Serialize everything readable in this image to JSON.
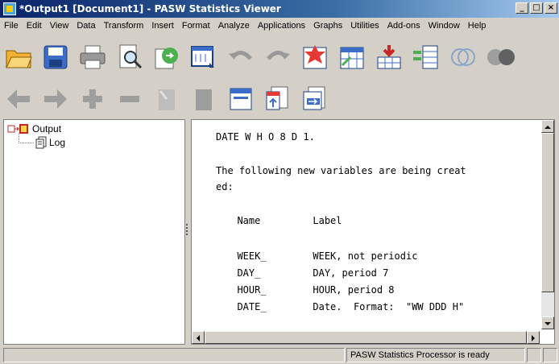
{
  "window": {
    "title": "*Output1 [Document1] - PASW Statistics Viewer",
    "controls": [
      "_",
      "□",
      "×"
    ]
  },
  "menu": [
    {
      "label": "File"
    },
    {
      "label": "Edit"
    },
    {
      "label": "View"
    },
    {
      "label": "Data"
    },
    {
      "label": "Transform"
    },
    {
      "label": "Insert"
    },
    {
      "label": "Format"
    },
    {
      "label": "Analyze"
    },
    {
      "label": "Applications"
    },
    {
      "label": "Graphs"
    },
    {
      "label": "Utilities"
    },
    {
      "label": "Add-ons"
    },
    {
      "label": "Window"
    },
    {
      "label": "Help"
    }
  ],
  "toolbar1": [
    "open-icon",
    "save-icon",
    "print-icon",
    "print-preview-icon",
    "export-icon",
    "goto-data-icon",
    "undo-icon",
    "redo-icon",
    "goto-case-icon",
    "goto-variable-icon",
    "insert-cases-icon",
    "split-file-icon",
    "select-cases-icon",
    "value-labels-icon"
  ],
  "toolbar2": [
    "promote-icon",
    "demote-icon",
    "expand-icon",
    "collapse-icon",
    "show-icon",
    "hide-icon",
    "insert-heading-icon",
    "insert-title-icon",
    "insert-text-icon"
  ],
  "outline": {
    "root": "Output",
    "child": "Log"
  },
  "log": {
    "lines": [
      "DATE W H O 8 D 1.",
      "",
      "The following new variables are being creat",
      "ed:",
      "",
      "  Name         Label",
      "",
      "  WEEK_        WEEK, not periodic",
      "  DAY_         DAY, period 7",
      "  HOUR_        HOUR, period 8",
      "  DATE_        Date.  Format:  \"WW DDD H\""
    ]
  },
  "status": {
    "message": "PASW Statistics Processor is ready"
  },
  "colors": {
    "titlebar_start": "#0a246a",
    "titlebar_end": "#a6caf0",
    "chrome": "#d4d0c8"
  }
}
